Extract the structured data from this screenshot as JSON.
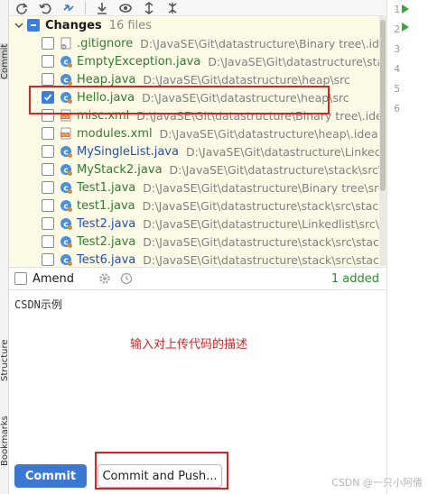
{
  "toolbar": {
    "icons": [
      "refresh-icon",
      "rollback-icon",
      "diff-icon",
      "open-file-icon",
      "download-icon",
      "eye-icon",
      "expand-all-icon",
      "collapse-all-icon"
    ]
  },
  "changes": {
    "label": "Changes",
    "count": "16 files",
    "files": [
      {
        "name": ".gitignore",
        "path": "D:\\JavaSE\\Git\\datastructure\\Binary tree\\.idea",
        "icon": "gitignore-file-icon",
        "checked": false,
        "color": "green"
      },
      {
        "name": "EmptyException.java",
        "path": "D:\\JavaSE\\Git\\datastructure\\stack\\src\\stack",
        "icon": "java-class-icon",
        "checked": false,
        "color": "green"
      },
      {
        "name": "Heap.java",
        "path": "D:\\JavaSE\\Git\\datastructure\\heap\\src",
        "icon": "java-class-icon",
        "checked": false,
        "color": "green"
      },
      {
        "name": "Hello.java",
        "path": "D:\\JavaSE\\Git\\datastructure\\heap\\src",
        "icon": "java-class-icon",
        "checked": true,
        "color": "green"
      },
      {
        "name": "misc.xml",
        "path": "D:\\JavaSE\\Git\\datastructure\\Binary tree\\.idea",
        "icon": "xml-file-icon",
        "checked": false,
        "color": "green"
      },
      {
        "name": "modules.xml",
        "path": "D:\\JavaSE\\Git\\datastructure\\heap\\.idea",
        "icon": "xml-file-icon",
        "checked": false,
        "color": "green"
      },
      {
        "name": "MySingleList.java",
        "path": "D:\\JavaSE\\Git\\datastructure\\Linkedlist\\src\\",
        "icon": "java-class-icon",
        "checked": false,
        "color": "blue"
      },
      {
        "name": "MyStack2.java",
        "path": "D:\\JavaSE\\Git\\datastructure\\stack\\src\\stack",
        "icon": "java-class-icon",
        "checked": false,
        "color": "green"
      },
      {
        "name": "Test1.java",
        "path": "D:\\JavaSE\\Git\\datastructure\\Binary tree\\src",
        "icon": "java-class-icon",
        "checked": false,
        "color": "green"
      },
      {
        "name": "test1.java",
        "path": "D:\\JavaSE\\Git\\datastructure\\stack\\src\\stack",
        "icon": "java-class-icon",
        "checked": false,
        "color": "green"
      },
      {
        "name": "Test2.java",
        "path": "D:\\JavaSE\\Git\\datastructure\\Linkedlist\\src\\linkedL",
        "icon": "java-class-icon",
        "checked": false,
        "color": "blue"
      },
      {
        "name": "Test2.java",
        "path": "D:\\JavaSE\\Git\\datastructure\\stack\\src\\stack",
        "icon": "java-class-icon",
        "checked": false,
        "color": "green"
      },
      {
        "name": "Test6.java",
        "path": "D:\\JavaSE\\Git\\datastructure\\stack\\src\\stack",
        "icon": "java-class-icon",
        "checked": false,
        "color": "blue"
      }
    ]
  },
  "amend": {
    "label": "Amend",
    "status": "1 added"
  },
  "message": {
    "text": "CSDN示例",
    "hint": "输入对上传代码的描述"
  },
  "buttons": {
    "commit": "Commit",
    "commit_push": "Commit and Push..."
  },
  "side_tabs": {
    "commit": "Commit",
    "structure": "Structure",
    "bookmarks": "Bookmarks"
  },
  "editor": {
    "line_numbers": [
      "1",
      "2",
      "3",
      "4",
      "5",
      "6"
    ]
  },
  "watermark": "CSDN @一只小阿倩",
  "colors": {
    "accent": "#3a78d4",
    "annotation": "#e11d1d",
    "added": "#2e8b2e",
    "tree_bg": "#fdfbe5"
  }
}
